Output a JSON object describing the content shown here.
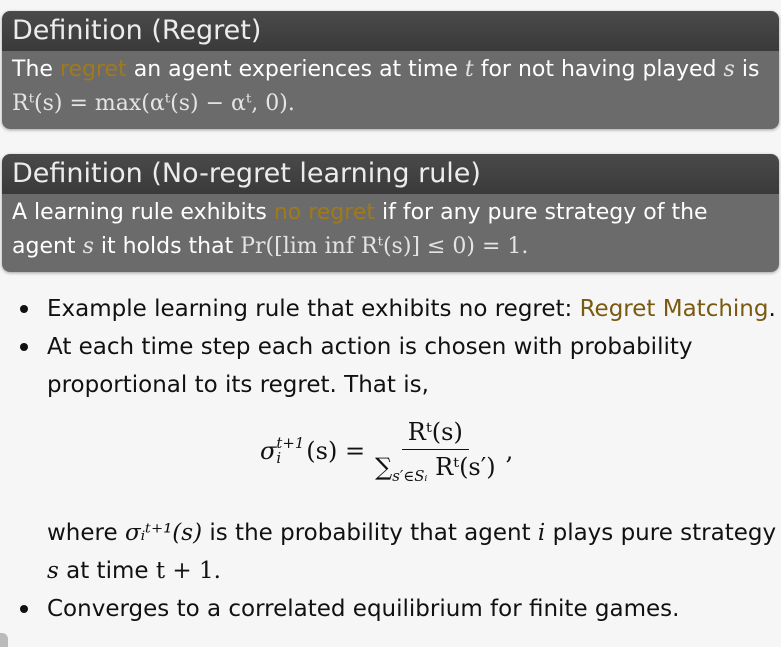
{
  "def1": {
    "title": "Definition (Regret)",
    "pre": "The",
    "highlight": "regret",
    "mid": "an agent experiences at time",
    "var_t": "t",
    "mid2": "for not having played",
    "var_s": "s",
    "post": "is",
    "formula": "Rᵗ(s) = max(αᵗ(s) − αᵗ, 0)."
  },
  "def2": {
    "title": "Definition (No-regret learning rule)",
    "pre": "A learning rule exhibits",
    "highlight": "no regret",
    "post": "if for any pure strategy of the",
    "line2_pre": "agent",
    "var_s": "s",
    "line2_mid": "it holds that",
    "formula": "Pr([lim inf Rᵗ(s)] ≤ 0) = 1."
  },
  "bullets": {
    "b1_pre": "Example learning rule that exhibits no regret:",
    "b1_link": "Regret Matching",
    "b1_post": ".",
    "b2_line1": "At each time step each action is chosen with probability",
    "b2_line2": "proportional to its regret.  That is,",
    "where_pre": "where",
    "where_sym": "σᵢᵗ⁺¹(s)",
    "where_mid": "is the probability that agent",
    "where_i": "i",
    "where_post": "plays pure strategy",
    "line_s": "s",
    "line_mid": "at time",
    "line_t": "t + 1.",
    "b3": "Converges to a correlated equilibrium for finite games."
  },
  "equation": {
    "lhs_base": "σ",
    "lhs_sub": "i",
    "lhs_sup": "t+1",
    "lhs_arg": "(s) =",
    "num": "Rᵗ(s)",
    "den_sum": "∑",
    "den_sub": "s′∈Sᵢ",
    "den_term": "Rᵗ(s′)",
    "tail": ","
  },
  "colors": {
    "highlight": "#a07a1a",
    "link": "#7a5a10",
    "block_head": "#3a3a3a",
    "block_body": "#6b6b6b"
  }
}
